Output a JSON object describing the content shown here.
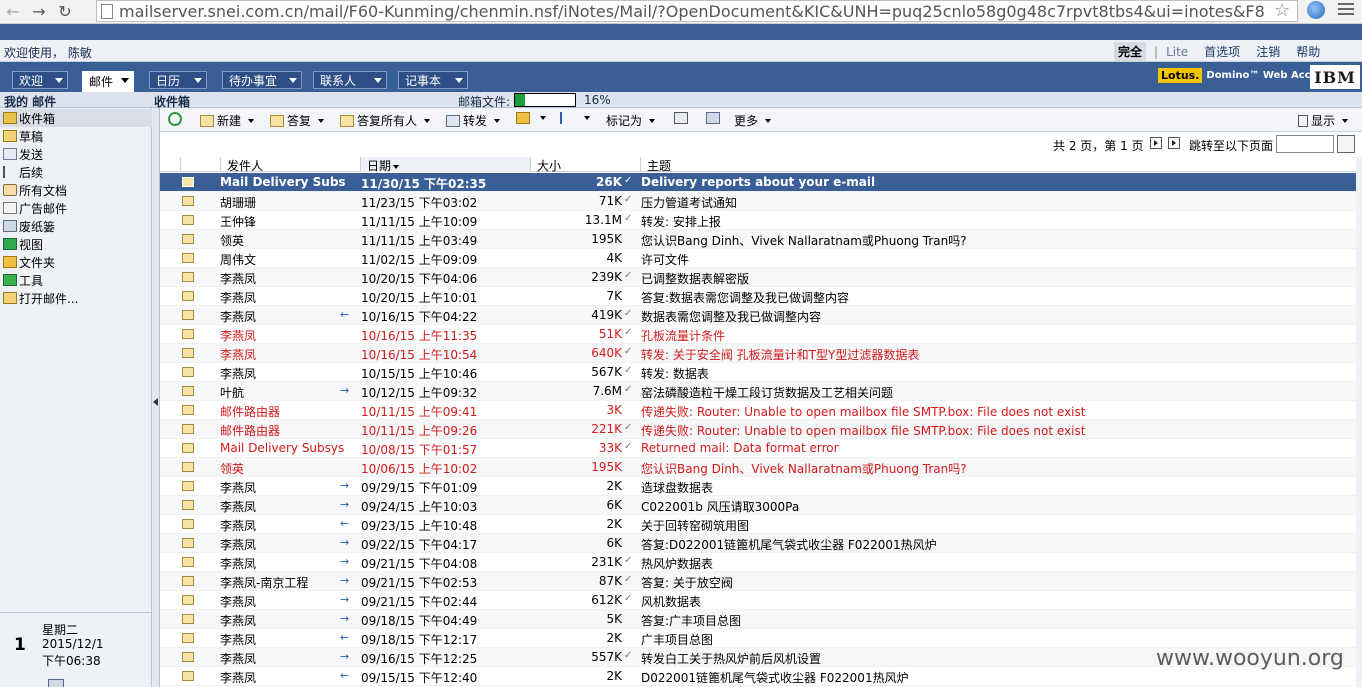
{
  "browser": {
    "url": "mailserver.snei.com.cn/mail/F60-Kunming/chenmin.nsf/iNotes/Mail/?OpenDocument&KIC&UNH=puq25cnlo58g0g48c7rpvt8tbs4&ui=inotes&F8",
    "back_glyph": "←",
    "forward_glyph": "→",
    "reload_glyph": "↻",
    "star_glyph": "☆"
  },
  "header": {
    "welcome": "欢迎使用， 陈敏",
    "links": {
      "full": "完全",
      "sep": "|",
      "lite": "Lite",
      "prefs": "首选项",
      "logout": "注销",
      "help": "帮助"
    }
  },
  "tabs": [
    {
      "label": "欢迎",
      "active": false
    },
    {
      "label": "邮件",
      "active": true
    },
    {
      "label": "日历",
      "active": false
    },
    {
      "label": "待办事宜",
      "active": false
    },
    {
      "label": "联系人",
      "active": false
    },
    {
      "label": "记事本",
      "active": false
    }
  ],
  "brand": {
    "lotus": "Lotus.",
    "domino": "Domino™ Web Access",
    "ibm": "IBM"
  },
  "section": {
    "my_mail": "我的 邮件",
    "inbox": "收件箱",
    "quota_label": "邮箱文件:",
    "quota_percent": "16%",
    "quota_fraction": 0.16
  },
  "sidebar": {
    "items": [
      {
        "label": "收件箱",
        "icon": "inbox-icon",
        "selected": true
      },
      {
        "label": "草稿",
        "icon": "draft-icon"
      },
      {
        "label": "发送",
        "icon": "sent-icon"
      },
      {
        "label": "后续",
        "icon": "follow-up-icon"
      },
      {
        "label": "所有文档",
        "icon": "all-documents-icon"
      },
      {
        "label": "广告邮件",
        "icon": "junk-icon"
      },
      {
        "label": "废纸篓",
        "icon": "trash-icon"
      },
      {
        "label": "视图",
        "icon": "views-icon"
      },
      {
        "label": "文件夹",
        "icon": "folders-icon"
      },
      {
        "label": "工具",
        "icon": "tools-icon"
      },
      {
        "label": "打开邮件...",
        "icon": "open-mail-icon"
      }
    ],
    "date": {
      "day": "1",
      "weekday": "星期二",
      "date": "2015/12/1",
      "time": "下午06:38"
    }
  },
  "toolbar": {
    "new": "新建",
    "reply": "答复",
    "reply_all": "答复所有人",
    "forward": "转发",
    "mark_as": "标记为",
    "more": "更多",
    "display": "显示"
  },
  "pager": {
    "text": "共 2 页，第 1 页",
    "jump_label": "跳转至以下页面"
  },
  "columns": {
    "from": "发件人",
    "date": "日期",
    "size": "大小",
    "subject": "主题"
  },
  "rows": [
    {
      "from": "Mail Delivery Subsys",
      "flag": "",
      "date": "11/30/15 下午02:35",
      "size": "26K",
      "att": "✓",
      "subject": "Delivery reports about your e-mail",
      "state": "sel"
    },
    {
      "from": "胡珊珊",
      "flag": "",
      "date": "11/23/15 下午03:02",
      "size": "71K",
      "att": "✓",
      "subject": "压力管道考试通知",
      "state": ""
    },
    {
      "from": "王仲锋",
      "flag": "",
      "date": "11/11/15 上午10:09",
      "size": "13.1M",
      "att": "✓",
      "subject": "转发: 安排上报",
      "state": ""
    },
    {
      "from": "领英",
      "flag": "",
      "date": "11/11/15 上午03:49",
      "size": "195K",
      "att": "",
      "subject": "您认识Bang Dinh、Vivek Nallaratnam或Phuong Tran吗?",
      "state": ""
    },
    {
      "from": "周伟文",
      "flag": "",
      "date": "11/02/15 上午09:09",
      "size": "4K",
      "att": "",
      "subject": "许可文件",
      "state": ""
    },
    {
      "from": "李燕凤",
      "flag": "",
      "date": "10/20/15 下午04:06",
      "size": "239K",
      "att": "✓",
      "subject": "已调整数据表解密版",
      "state": ""
    },
    {
      "from": "李燕凤",
      "flag": "",
      "date": "10/20/15 上午10:01",
      "size": "7K",
      "att": "",
      "subject": "答复:数据表需您调整及我已做调整内容",
      "state": ""
    },
    {
      "from": "李燕凤",
      "flag": "←",
      "date": "10/16/15 下午04:22",
      "size": "419K",
      "att": "✓",
      "subject": "数据表需您调整及我已做调整内容",
      "state": ""
    },
    {
      "from": "李燕凤",
      "flag": "",
      "date": "10/16/15 上午11:35",
      "size": "51K",
      "att": "✓",
      "subject": "孔板流量计条件",
      "state": "unread"
    },
    {
      "from": "李燕凤",
      "flag": "",
      "date": "10/16/15 上午10:54",
      "size": "640K",
      "att": "✓",
      "subject": "转发: 关于安全阀 孔板流量计和T型Y型过滤器数据表",
      "state": "unread"
    },
    {
      "from": "李燕凤",
      "flag": "",
      "date": "10/15/15 上午10:46",
      "size": "567K",
      "att": "✓",
      "subject": "转发: 数据表",
      "state": ""
    },
    {
      "from": "叶航",
      "flag": "→",
      "date": "10/12/15 上午09:32",
      "size": "7.6M",
      "att": "✓",
      "subject": "窑法磷酸造粒干燥工段订货数据及工艺相关问题",
      "state": ""
    },
    {
      "from": "邮件路由器",
      "flag": "",
      "date": "10/11/15 上午09:41",
      "size": "3K",
      "att": "",
      "subject": "传递失败: Router: Unable to open mailbox file SMTP.box: File does not exist",
      "state": "unread"
    },
    {
      "from": "邮件路由器",
      "flag": "",
      "date": "10/11/15 上午09:26",
      "size": "221K",
      "att": "✓",
      "subject": "传递失败: Router: Unable to open mailbox file SMTP.box: File does not exist",
      "state": "unread"
    },
    {
      "from": "Mail Delivery Subsys",
      "flag": "",
      "date": "10/08/15 下午01:57",
      "size": "33K",
      "att": "✓",
      "subject": "Returned mail: Data format error",
      "state": "unread"
    },
    {
      "from": "领英",
      "flag": "",
      "date": "10/06/15 上午10:02",
      "size": "195K",
      "att": "",
      "subject": "您认识Bang Dinh、Vivek Nallaratnam或Phuong Tran吗?",
      "state": "unread"
    },
    {
      "from": "李燕凤",
      "flag": "→",
      "date": "09/29/15 下午01:09",
      "size": "2K",
      "att": "",
      "subject": "造球盘数据表",
      "state": ""
    },
    {
      "from": "李燕凤",
      "flag": "→",
      "date": "09/24/15 上午10:03",
      "size": "6K",
      "att": "",
      "subject": " C022001b 风压请取3000Pa",
      "state": ""
    },
    {
      "from": "李燕凤",
      "flag": "←",
      "date": "09/23/15 上午10:48",
      "size": "2K",
      "att": "",
      "subject": "关于回转窑砌筑用图",
      "state": ""
    },
    {
      "from": "李燕凤",
      "flag": "→",
      "date": "09/22/15 下午04:17",
      "size": "6K",
      "att": "",
      "subject": "答复:D022001链篦机尾气袋式收尘器   F022001热风炉",
      "state": ""
    },
    {
      "from": "李燕凤",
      "flag": "→",
      "date": "09/21/15 下午04:08",
      "size": "231K",
      "att": "✓",
      "subject": "热风炉数据表",
      "state": ""
    },
    {
      "from": "李燕凤-南京工程",
      "flag": "→",
      "date": "09/21/15 下午02:53",
      "size": "87K",
      "att": "✓",
      "subject": "答复: 关于放空阀",
      "state": ""
    },
    {
      "from": "李燕凤",
      "flag": "→",
      "date": "09/21/15 下午02:44",
      "size": "612K",
      "att": "✓",
      "subject": "风机数据表",
      "state": ""
    },
    {
      "from": "李燕凤",
      "flag": "→",
      "date": "09/18/15 下午04:49",
      "size": "5K",
      "att": "",
      "subject": "答复:广丰项目总图",
      "state": ""
    },
    {
      "from": "李燕凤",
      "flag": "←",
      "date": "09/18/15 下午12:17",
      "size": "2K",
      "att": "",
      "subject": "广丰项目总图",
      "state": ""
    },
    {
      "from": "李燕凤",
      "flag": "→",
      "date": "09/16/15 下午12:25",
      "size": "557K",
      "att": "✓",
      "subject": "转发白工关于热风炉前后风机设置",
      "state": ""
    },
    {
      "from": "李燕凤",
      "flag": "←",
      "date": "09/15/15 下午12:40",
      "size": "2K",
      "att": "",
      "subject": "D022001链篦机尾气袋式收尘器   F022001热风炉",
      "state": ""
    }
  ],
  "watermark": "www.wooyun.org",
  "colors": {
    "band": "#3a5e96",
    "unread": "#d21a1a",
    "selected_row": "#3a5e96",
    "quota_fill": "#1e9e38"
  }
}
